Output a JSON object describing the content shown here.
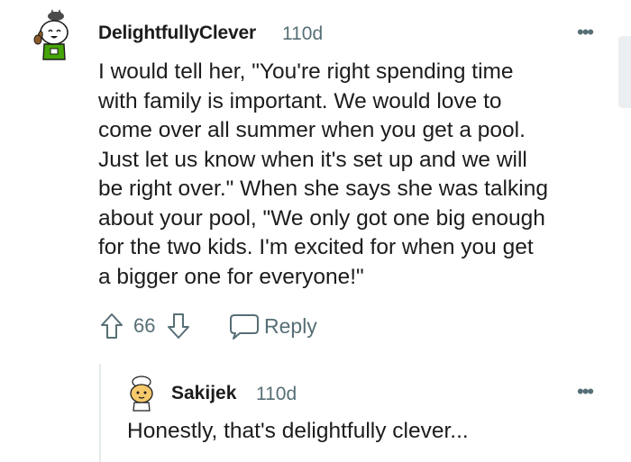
{
  "comment": {
    "username": "DelightfullyClever",
    "age": "110d",
    "more_icon": "more-horizontal-icon",
    "body_lines": [
      "I would tell her, \"You're right spending time",
      "with family is important. We would love to",
      "come over all summer when you get a pool.",
      "Just let us know when it's set up and we will",
      "be right over.\" When she says she was talking",
      "about your pool, \"We only got one big enough",
      "for the two kids. I'm excited for when you get",
      "a bigger one for everyone!\""
    ],
    "score": "66",
    "reply_label": "Reply",
    "upvote_icon": "upvote-arrow-icon",
    "downvote_icon": "downvote-arrow-icon",
    "reply_icon": "chat-bubble-icon"
  },
  "reply": {
    "username": "Sakijek",
    "age": "110d",
    "more_icon": "more-horizontal-icon",
    "body": "Honestly, that's delightfully clever..."
  },
  "colors": {
    "text": "#1c1c1c",
    "meta": "#576f76",
    "thread_line": "#e5ebee",
    "avatar_green": "#46a508"
  }
}
